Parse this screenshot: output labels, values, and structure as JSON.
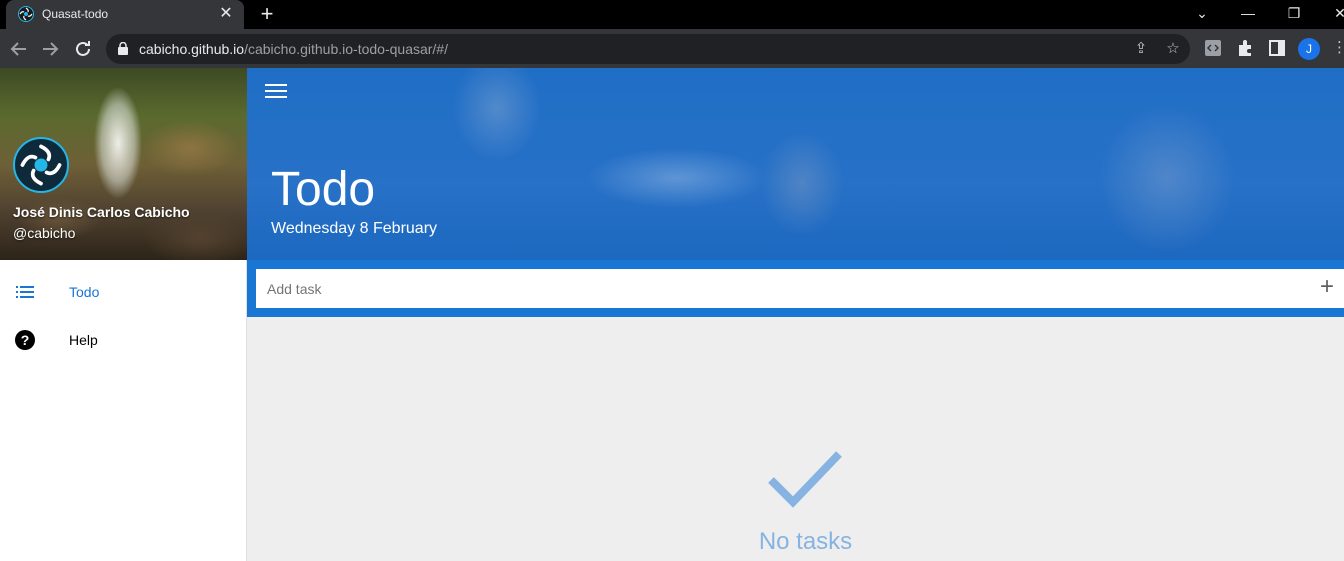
{
  "browser": {
    "tab_title": "Quasat-todo",
    "tab_close_icon": "close-icon",
    "new_tab_icon": "plus-icon",
    "url_host": "cabicho.github.io",
    "url_path": "/cabicho.github.io-todo-quasar/#/",
    "profile_initial": "J",
    "window_minimize": "—",
    "window_restore": "❐",
    "window_close": "✕",
    "tab_search": "⌄"
  },
  "drawer": {
    "user_name": "José Dinis Carlos Cabicho",
    "user_handle": "@cabicho",
    "items": [
      {
        "label": "Todo",
        "icon": "list-icon",
        "active": true,
        "color": "#1976d2"
      },
      {
        "label": "Help",
        "icon": "help-icon",
        "active": false,
        "color": "#000000"
      }
    ]
  },
  "header": {
    "title": "Todo",
    "date": "Wednesday 8 February"
  },
  "add_task": {
    "placeholder": "Add task",
    "value": ""
  },
  "empty_state": {
    "icon": "check-icon",
    "text": "No tasks"
  },
  "colors": {
    "primary": "#1976d2",
    "empty_accent": "#87b3e2"
  }
}
